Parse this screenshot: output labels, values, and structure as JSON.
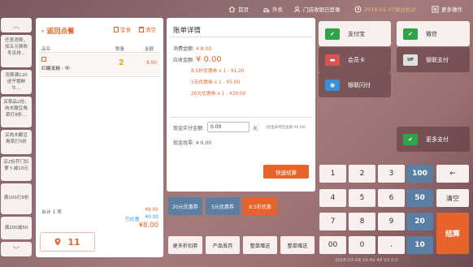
{
  "topbar": {
    "home": "首页",
    "takeout": "外卖",
    "staff_login": "门店收银已登录",
    "business_day": "2018-02-07营业始对",
    "more_ops": "更多操作"
  },
  "left_rail": {
    "items": [
      "任意消费，加五元换购冬瓜排...",
      "消费满120送干锅鲜牛…",
      "买菜品2份，肉木酿豆角菜打8折…",
      "买肉木酿豆角菜打5折",
      "买2份芥门红萝卜减10元",
      "满100打8折",
      "满200减50"
    ]
  },
  "order": {
    "back_label": "返回点餐",
    "hall_label": "堂食",
    "clear_label": "清空",
    "col_name": "品名",
    "col_qty": "数量",
    "col_amount": "金额",
    "dish_name": "红糖发糕 - 中",
    "dish_qty": "2",
    "dish_price": "8.00",
    "total_label": "合计 1 项",
    "total_amount": "¥8.00",
    "discount_label": "已优惠",
    "discount_amount": "¥0.00",
    "grand_total": "¥8.00",
    "table_no": "11"
  },
  "bill": {
    "title": "账单详情",
    "consume_label": "消费金额:",
    "consume_value": "¥ 8.00",
    "due_label": "应收金额:",
    "due_value": "¥ 0.00",
    "discounts": [
      "8.5折优惠券 x 1  -  ¥1.20",
      "5元优惠券 x 1  -  ¥5.00",
      "20元优惠券 x 1  -  ¥20.00"
    ],
    "cash_label": "现金实付金额:",
    "cash_value": "0.00",
    "cash_unit": "元",
    "cash_note": "(现金抹零后金额:¥0.00)",
    "change_label": "现金找零:",
    "change_value": "¥ 0.00",
    "quick_settle": "快速结算"
  },
  "coupons": [
    "20元优惠券",
    "5元优惠券",
    "8.5折优惠"
  ],
  "actions": [
    "更多折扣券",
    "产品丢弃",
    "整单赠送",
    "整单赠送"
  ],
  "payments": {
    "alipay": "支付宝",
    "wechat": "微信",
    "member_card": "会员卡",
    "unionpay": "银联支付",
    "unionpay_quick": "银联闪付",
    "more_pay": "更多支付"
  },
  "keypad": {
    "keys": [
      "1",
      "2",
      "3",
      "4",
      "5",
      "6",
      "7",
      "8",
      "9",
      "00",
      "0",
      "."
    ],
    "quick": [
      "100",
      "50",
      "20",
      "10"
    ],
    "clear": "清空",
    "settle": "结算"
  },
  "status_bar": "2018-03-08 16:41:48 V2.0.0",
  "colors": {
    "accent": "#e8632c",
    "blue": "#5b7fa3",
    "alipay_green": "#2ea44a",
    "wechat_green": "#2ea44a"
  }
}
